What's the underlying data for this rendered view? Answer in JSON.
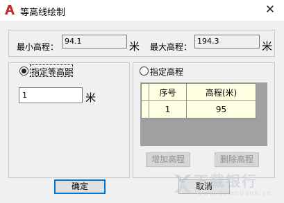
{
  "window": {
    "title": "等高线绘制",
    "close_glyph": "✕"
  },
  "range": {
    "min_label": "最小高程：",
    "min_value": "94.1",
    "min_unit": "米",
    "max_label": "最大高程：",
    "max_value": "194.3",
    "max_unit": "米"
  },
  "mode_interval": {
    "label": "指定等高距",
    "selected": true,
    "value": "1",
    "unit": "米"
  },
  "mode_elevation": {
    "label": "指定高程",
    "selected": false,
    "table": {
      "columns": [
        "序号",
        "高程(米)"
      ],
      "rows": [
        {
          "index": "1",
          "elevation": "95"
        }
      ]
    },
    "add_label": "增加高程",
    "delete_label": "删除高程"
  },
  "buttons": {
    "ok_label": "确定",
    "cancel_label": "取消"
  },
  "watermark": {
    "text_cn": "下载银行",
    "text_en": "www.downbank.cn"
  },
  "colors": {
    "app_icon": "#c8262c",
    "focus_border": "#0078d7",
    "table_bg": "#ffffe1",
    "table_empty": "#a0a0a0"
  }
}
